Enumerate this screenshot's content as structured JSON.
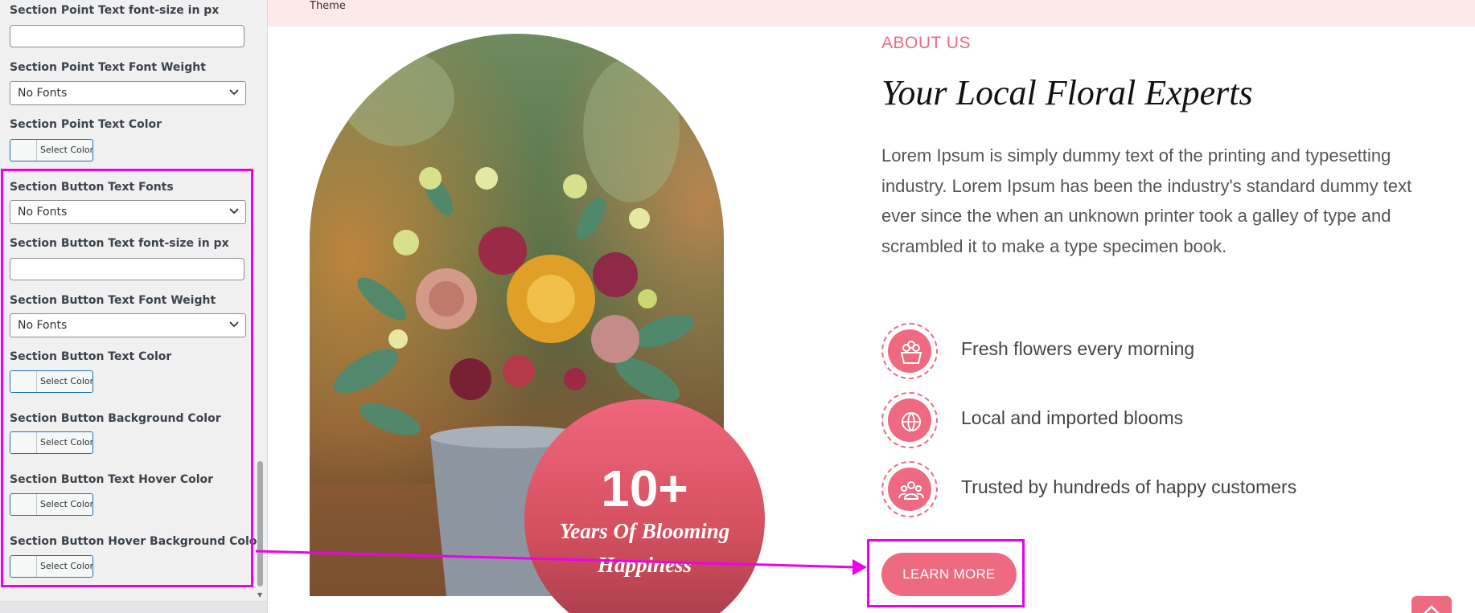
{
  "panel": {
    "fields": [
      {
        "label": "Section Point Text font-size in px",
        "type": "text",
        "value": ""
      },
      {
        "label": "Section Point Text Font Weight",
        "type": "select",
        "value": "No Fonts"
      },
      {
        "label": "Section Point Text Color",
        "type": "color",
        "button_text": "Select Color"
      },
      {
        "label": "Section Button Text Fonts",
        "type": "select",
        "value": "No Fonts"
      },
      {
        "label": "Section Button Text font-size in px",
        "type": "text",
        "value": ""
      },
      {
        "label": "Section Button Text Font Weight",
        "type": "select",
        "value": "No Fonts"
      },
      {
        "label": "Section Button Text Color",
        "type": "color",
        "button_text": "Select Color"
      },
      {
        "label": "Section Button Background Color",
        "type": "color",
        "button_text": "Select Color"
      },
      {
        "label": "Section Button Text Hover Color",
        "type": "color",
        "button_text": "Select Color"
      },
      {
        "label": "Section Button Hover Background Color",
        "type": "color",
        "button_text": "Select Color"
      }
    ]
  },
  "preview": {
    "topbar_text": "Theme",
    "about_label": "ABOUT US",
    "heading": "Your Local Floral Experts",
    "paragraph": "Lorem Ipsum is simply dummy text of the printing and typesetting industry. Lorem Ipsum has been the industry's standard dummy text ever since the when an unknown printer took a galley of type and scrambled it to make a type specimen book.",
    "points": [
      {
        "icon": "flower-basket-icon",
        "text": "Fresh flowers every morning"
      },
      {
        "icon": "globe-flower-icon",
        "text": "Local and imported blooms"
      },
      {
        "icon": "happy-customers-icon",
        "text": "Trusted by hundreds of happy customers"
      }
    ],
    "badge": {
      "number": "10+",
      "subtitle_line1": "Years Of Blooming",
      "subtitle_line2": "Happiness"
    },
    "button_label": "LEARN MORE"
  },
  "colors": {
    "accent": "#ee6a80",
    "annotation": "#ee00ee",
    "topbar_bg": "#fde8ea",
    "panel_bg": "#f0f0f1"
  }
}
